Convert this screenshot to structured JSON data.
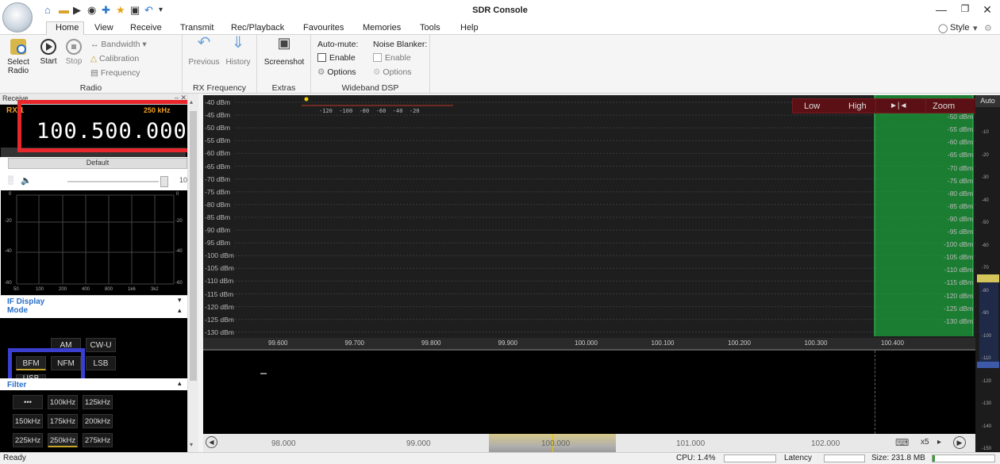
{
  "window": {
    "title": "SDR Console",
    "minimize": "—",
    "restore": "❐",
    "close": "✕"
  },
  "menu": {
    "home": "Home",
    "view": "View",
    "receive": "Receive",
    "transmit": "Transmit",
    "rec_playback": "Rec/Playback",
    "favourites": "Favourites",
    "memories": "Memories",
    "tools": "Tools",
    "help": "Help",
    "style": "Style"
  },
  "ribbon": {
    "radio": {
      "label": "Radio",
      "select": "Select\nRadio",
      "start": "Start",
      "stop": "Stop",
      "bandwidth": "Bandwidth",
      "calibration": "Calibration",
      "frequency": "Frequency"
    },
    "rx_frequency": {
      "label": "RX Frequency",
      "previous": "Previous",
      "history": "History"
    },
    "extras": {
      "label": "Extras",
      "screenshot": "Screenshot"
    },
    "wideband_dsp": {
      "label": "Wideband DSP",
      "auto_mute": "Auto-mute:",
      "noise_blanker": "Noise Blanker:",
      "enable1": "Enable",
      "enable2": "Enable",
      "options1": "Options",
      "options2": "Options"
    }
  },
  "receive_panel": {
    "header": "Receive",
    "rx": "RX 1",
    "bandwidth": "250 kHz",
    "frequency": "100.500.000",
    "default_label": "Default",
    "volume_value": "10",
    "graph_ticks_left": [
      "0",
      "-20",
      "-40",
      "-60"
    ],
    "graph_ticks_right": [
      "0",
      "-20",
      "-40",
      "-60"
    ],
    "graph_x": [
      "50",
      "100",
      "200",
      "400",
      "800",
      "1k6",
      "3k2"
    ]
  },
  "if_display": {
    "header": "IF Display"
  },
  "mode": {
    "header": "Mode",
    "buttons": [
      "AM",
      "CW-U",
      "BFM",
      "NFM",
      "LSB",
      "USB"
    ]
  },
  "filter": {
    "header": "Filter",
    "buttons": [
      "•••",
      "100kHz",
      "125kHz",
      "150kHz",
      "175kHz",
      "200kHz",
      "225kHz",
      "250kHz",
      "275kHz"
    ]
  },
  "spectrum": {
    "dbm_labels": [
      "-40 dBm",
      "-45 dBm",
      "-50 dBm",
      "-55 dBm",
      "-60 dBm",
      "-65 dBm",
      "-70 dBm",
      "-75 dBm",
      "-80 dBm",
      "-85 dBm",
      "-90 dBm",
      "-95 dBm",
      "-100 dBm",
      "-105 dBm",
      "-110 dBm",
      "-115 dBm",
      "-120 dBm",
      "-125 dBm",
      "-130 dBm"
    ],
    "smeter_scale": [
      "-120",
      "-100",
      "-80",
      "-60",
      "-40",
      "-20"
    ],
    "controls": {
      "low": "Low",
      "high": "High",
      "arrows": "►|◄",
      "zoom": "Zoom"
    },
    "freq_axis": [
      "99.600",
      "99.700",
      "99.800",
      "99.900",
      "100.000",
      "100.100",
      "100.200",
      "100.300",
      "100.400"
    ],
    "band_axis": [
      "98.000",
      "99.000",
      "100.000",
      "101.000",
      "102.000"
    ],
    "zoom_factor": "x5"
  },
  "right_scale": {
    "auto": "Auto",
    "ticks": [
      "-10",
      "-20",
      "-30",
      "-40",
      "-50",
      "-60",
      "-70",
      "-80",
      "-90",
      "-100",
      "-110",
      "-120",
      "-130",
      "-140",
      "-150"
    ]
  },
  "status": {
    "ready": "Ready",
    "cpu": "CPU: 1.4%",
    "latency": "Latency",
    "size": "Size: 231.8 MB"
  },
  "colors": {
    "highlight_red": "#e8262b",
    "highlight_blue": "#3b3fcf",
    "passband_green": "#1b9d3a",
    "accent_blue": "#2a6fc9"
  }
}
